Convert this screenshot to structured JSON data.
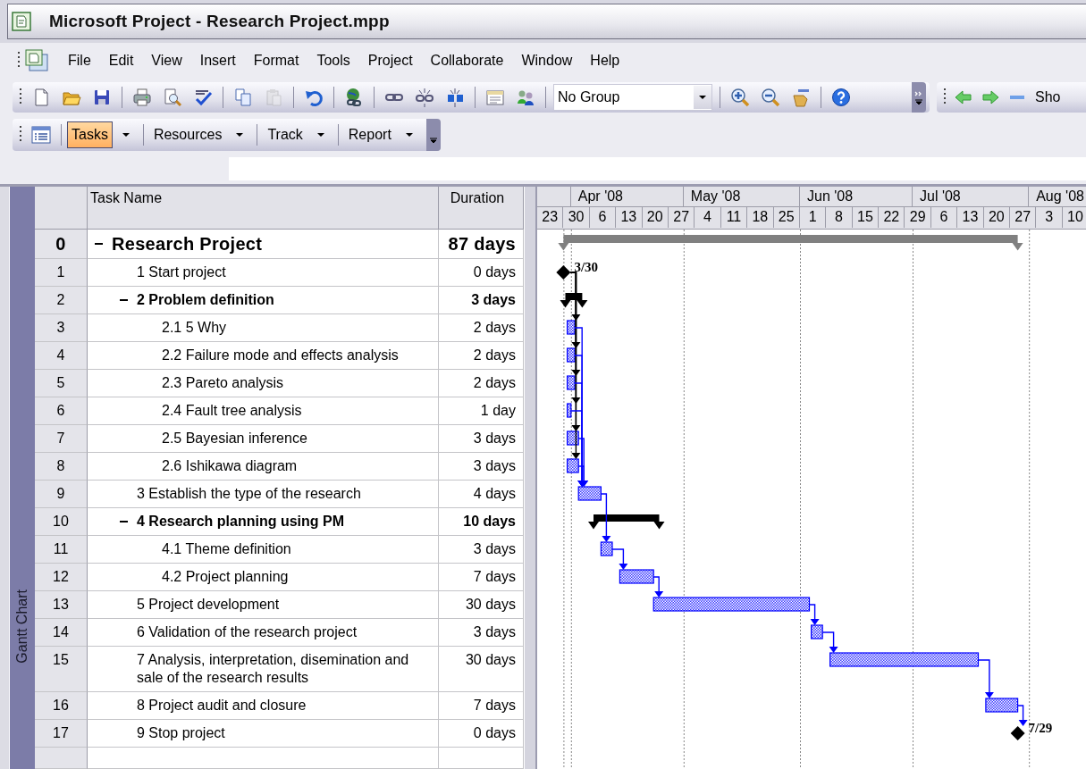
{
  "window": {
    "title": "Microsoft Project - Research Project.mpp"
  },
  "menu_bar": {
    "items": [
      {
        "label": "File"
      },
      {
        "label": "Edit"
      },
      {
        "label": "View"
      },
      {
        "label": "Insert"
      },
      {
        "label": "Format"
      },
      {
        "label": "Tools"
      },
      {
        "label": "Project"
      },
      {
        "label": "Collaborate"
      },
      {
        "label": "Window"
      },
      {
        "label": "Help"
      }
    ]
  },
  "standard_toolbar": {
    "items": [
      {
        "kind": "button",
        "disabled": false
      },
      {
        "kind": "button",
        "disabled": false
      },
      {
        "kind": "button",
        "disabled": false
      },
      {
        "kind": "separator"
      },
      {
        "kind": "button",
        "disabled": false
      },
      {
        "kind": "button",
        "disabled": false
      },
      {
        "kind": "button",
        "disabled": false
      },
      {
        "kind": "separator"
      },
      {
        "kind": "button",
        "disabled": false
      },
      {
        "kind": "button",
        "disabled": true
      },
      {
        "kind": "separator"
      },
      {
        "kind": "button",
        "disabled": false
      },
      {
        "kind": "separator"
      },
      {
        "kind": "button",
        "disabled": false
      },
      {
        "kind": "separator"
      },
      {
        "kind": "button",
        "disabled": false
      },
      {
        "kind": "button",
        "disabled": false
      },
      {
        "kind": "button",
        "disabled": false
      },
      {
        "kind": "separator"
      },
      {
        "kind": "button",
        "disabled": false
      },
      {
        "kind": "button",
        "disabled": false
      },
      {
        "kind": "separator"
      },
      {
        "kind": "combo",
        "value": "No Group"
      },
      {
        "kind": "separator"
      },
      {
        "kind": "button",
        "disabled": false
      },
      {
        "kind": "button",
        "disabled": false
      },
      {
        "kind": "button",
        "disabled": false
      },
      {
        "kind": "separator"
      },
      {
        "kind": "button",
        "disabled": false
      },
      {
        "kind": "options"
      }
    ]
  },
  "web_toolbar": {
    "items": [
      {
        "kind": "button",
        "disabled": false
      },
      {
        "kind": "button",
        "disabled": false
      },
      {
        "kind": "button",
        "disabled": false
      },
      {
        "kind": "label",
        "text": "Sho"
      }
    ]
  },
  "project_guide_toolbar": {
    "items": [
      {
        "label": "Tasks",
        "selected": true
      },
      {
        "label": "Resources",
        "selected": false
      },
      {
        "label": "Track",
        "selected": false
      },
      {
        "label": "Report",
        "selected": false
      }
    ]
  },
  "view_bar": {
    "label": "Gantt Chart"
  },
  "task_sheet": {
    "columns": [
      {
        "label": "Task Name"
      },
      {
        "label": "Duration"
      }
    ],
    "rows": [
      {
        "id": "0",
        "name": "Research Project",
        "duration": "87 days",
        "kind": "project",
        "expanded": true,
        "children": [
          {
            "id": "1",
            "name": "1 Start project",
            "duration": "0 days",
            "kind": "milestone"
          },
          {
            "id": "2",
            "name": "2 Problem definition",
            "duration": "3 days",
            "kind": "summary",
            "expanded": true,
            "children": [
              {
                "id": "3",
                "name": "2.1 5 Why",
                "duration": "2 days",
                "kind": "task"
              },
              {
                "id": "4",
                "name": "2.2 Failure mode and effects analysis",
                "duration": "2 days",
                "kind": "task"
              },
              {
                "id": "5",
                "name": "2.3 Pareto analysis",
                "duration": "2 days",
                "kind": "task"
              },
              {
                "id": "6",
                "name": "2.4 Fault tree analysis",
                "duration": "1 day",
                "kind": "task"
              },
              {
                "id": "7",
                "name": "2.5 Bayesian inference",
                "duration": "3 days",
                "kind": "task"
              },
              {
                "id": "8",
                "name": "2.6 Ishikawa diagram",
                "duration": "3 days",
                "kind": "task"
              }
            ]
          },
          {
            "id": "9",
            "name": "3 Establish the type of the research",
            "duration": "4 days",
            "kind": "task"
          },
          {
            "id": "10",
            "name": "4 Research planning using PM",
            "duration": "10 days",
            "kind": "summary",
            "expanded": true,
            "children": [
              {
                "id": "11",
                "name": "4.1 Theme definition",
                "duration": "3 days",
                "kind": "task"
              },
              {
                "id": "12",
                "name": "4.2 Project planning",
                "duration": "7 days",
                "kind": "task"
              }
            ]
          },
          {
            "id": "13",
            "name": "5 Project development",
            "duration": "30 days",
            "kind": "task"
          },
          {
            "id": "14",
            "name": "6 Validation of the research project",
            "duration": "3 days",
            "kind": "task"
          },
          {
            "id": "15",
            "name": "7 Analysis, interpretation, disemination and sale of the research results",
            "duration": "30 days",
            "kind": "task"
          },
          {
            "id": "16",
            "name": "8 Project audit and closure",
            "duration": "7 days",
            "kind": "task"
          },
          {
            "id": "17",
            "name": "9 Stop project",
            "duration": "0 days",
            "kind": "milestone"
          }
        ]
      }
    ]
  },
  "gantt": {
    "timescale": {
      "weeks": [
        {
          "label": "23"
        },
        {
          "label": "30"
        },
        {
          "label": "6"
        },
        {
          "label": "13"
        },
        {
          "label": "20"
        },
        {
          "label": "27"
        },
        {
          "label": "4"
        },
        {
          "label": "11"
        },
        {
          "label": "18"
        },
        {
          "label": "25"
        },
        {
          "label": "1"
        },
        {
          "label": "8"
        },
        {
          "label": "15"
        },
        {
          "label": "22"
        },
        {
          "label": "29"
        },
        {
          "label": "6"
        },
        {
          "label": "13"
        },
        {
          "label": "20"
        },
        {
          "label": "27"
        },
        {
          "label": "3"
        },
        {
          "label": "10"
        }
      ]
    },
    "months": [
      {
        "label": "Apr '08"
      },
      {
        "label": "May '08"
      },
      {
        "label": "Jun '08"
      },
      {
        "label": "Jul '08"
      },
      {
        "label": "Aug '08"
      }
    ],
    "milestone_labels": [
      {
        "label": "3/30"
      },
      {
        "label": "7/29"
      }
    ]
  }
}
